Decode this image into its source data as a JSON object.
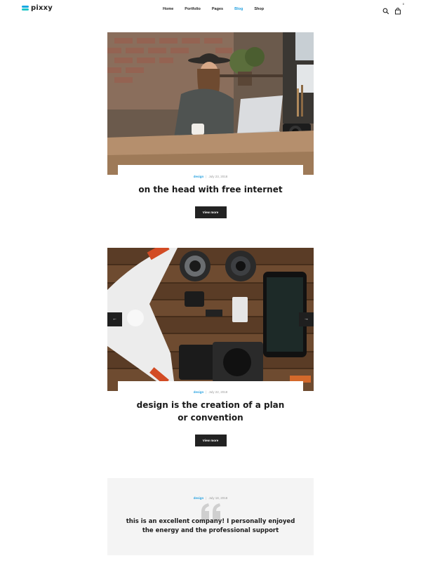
{
  "brand": {
    "name": "pixxy",
    "accent": "#27a2e0"
  },
  "nav": {
    "items": [
      {
        "label": "Home"
      },
      {
        "label": "Portfolio"
      },
      {
        "label": "Pages"
      },
      {
        "label": "Blog",
        "active": true
      },
      {
        "label": "Shop"
      }
    ]
  },
  "header": {
    "search_icon": "search-icon",
    "cart_icon": "cart-icon",
    "cart_count": "0"
  },
  "posts": [
    {
      "category": "design",
      "date": "July 23, 2018",
      "title": "on the head with free internet",
      "button": "View more",
      "image": "man-with-hat-at-laptop"
    },
    {
      "category": "design",
      "date": "July 22, 2018",
      "title": "design is the creation of a plan or convention",
      "button": "View more",
      "image": "drone-camera-lenses-phone-flatlay",
      "slider": {
        "prev": "←",
        "next": "→"
      }
    },
    {
      "category": "design",
      "date": "July 18, 2018",
      "quote": "this is an excellent company! I personally enjoyed the energy and the professional support",
      "icon": "quote-icon"
    }
  ]
}
